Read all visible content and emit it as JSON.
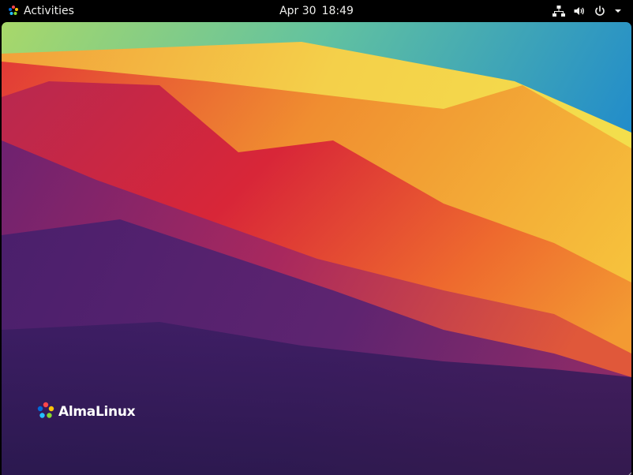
{
  "topbar": {
    "activities_label": "Activities",
    "clock": {
      "date": "Apr 30",
      "time": "18:49"
    },
    "tray_icons": [
      "network-wired-icon",
      "volume-icon",
      "power-icon",
      "dropdown-arrow-icon"
    ]
  },
  "desktop": {
    "wallpaper": "almalinux-gradient-dunes",
    "brand": {
      "text": "AlmaLinux",
      "logo": "almalinux-logo"
    }
  },
  "colors": {
    "topbar_bg": "#000000",
    "text": "#eeeeec",
    "wave_yellow": "#f6d23a",
    "wave_orange": "#f08a2e",
    "wave_red": "#d8263a",
    "wave_purple": "#5a2472",
    "wave_navy": "#2a1a52",
    "sky_blue": "#1e8cd0"
  }
}
